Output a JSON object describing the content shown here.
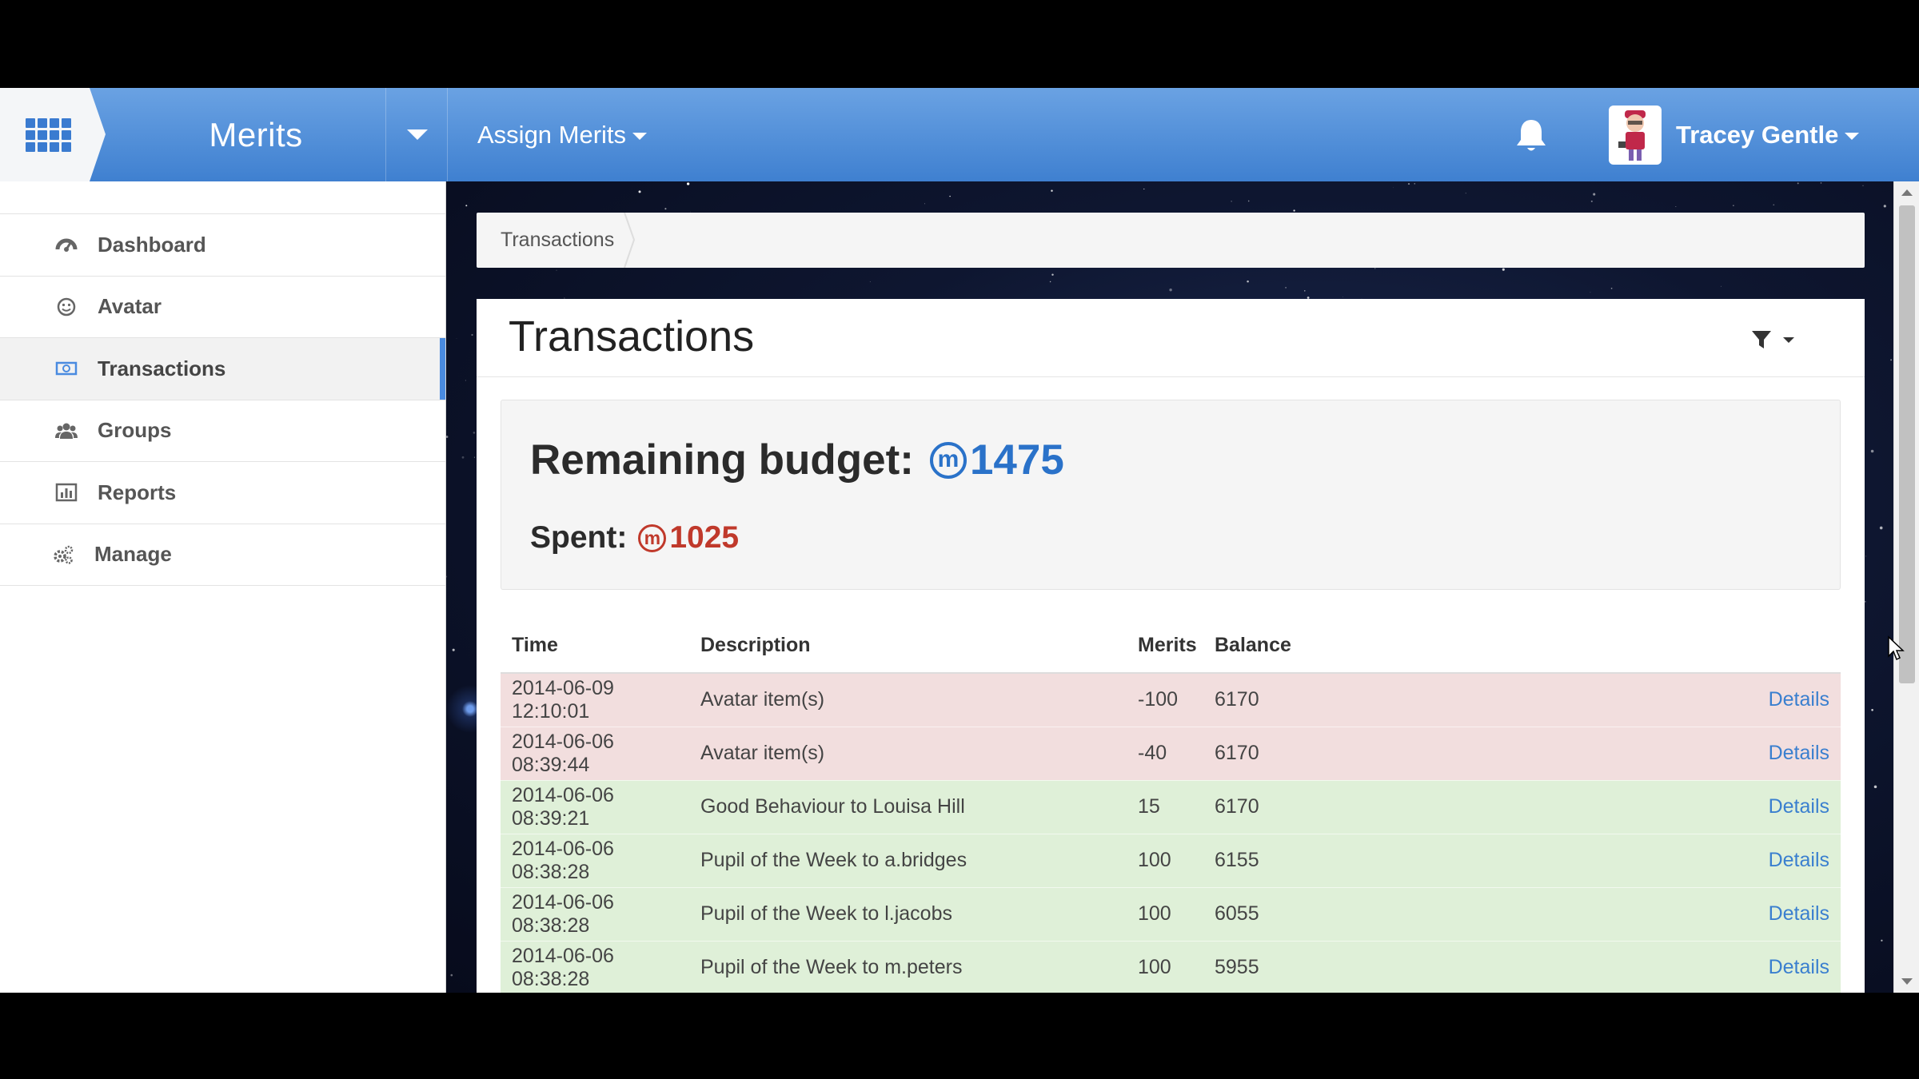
{
  "topbar": {
    "app_title": "Merits",
    "assign_menu": "Assign Merits",
    "user_name": "Tracey Gentle"
  },
  "sidebar": {
    "items": [
      {
        "label": "Dashboard",
        "icon": "dashboard-icon"
      },
      {
        "label": "Avatar",
        "icon": "smiley-icon"
      },
      {
        "label": "Transactions",
        "icon": "money-icon",
        "active": true
      },
      {
        "label": "Groups",
        "icon": "users-icon"
      },
      {
        "label": "Reports",
        "icon": "bar-chart-icon"
      },
      {
        "label": "Manage",
        "icon": "gears-icon"
      }
    ]
  },
  "breadcrumb": {
    "current": "Transactions"
  },
  "panel": {
    "title": "Transactions",
    "remaining_label": "Remaining budget:",
    "remaining_value": "1475",
    "spent_label": "Spent:",
    "spent_value": "1025",
    "merit_symbol": "m"
  },
  "table": {
    "headers": [
      "Time",
      "Description",
      "Merits",
      "Balance"
    ],
    "rows": [
      {
        "time": "2014-06-09 12:10:01",
        "description": "Avatar item(s)",
        "merits": "-100",
        "balance": "6170",
        "link": "Details"
      },
      {
        "time": "2014-06-06 08:39:44",
        "description": "Avatar item(s)",
        "merits": "-40",
        "balance": "6170",
        "link": "Details"
      },
      {
        "time": "2014-06-06 08:39:21",
        "description": "Good Behaviour to Louisa Hill",
        "merits": "15",
        "balance": "6170",
        "link": "Details"
      },
      {
        "time": "2014-06-06 08:38:28",
        "description": "Pupil of the Week to a.bridges",
        "merits": "100",
        "balance": "6155",
        "link": "Details"
      },
      {
        "time": "2014-06-06 08:38:28",
        "description": "Pupil of the Week to l.jacobs",
        "merits": "100",
        "balance": "6055",
        "link": "Details"
      },
      {
        "time": "2014-06-06 08:38:28",
        "description": "Pupil of the Week to m.peters",
        "merits": "100",
        "balance": "5955",
        "link": "Details"
      }
    ]
  },
  "colors": {
    "topbar": "#4a8ad8",
    "accent": "#2a72c9",
    "spent": "#c0392b",
    "negative_row": "#f2dede",
    "positive_row": "#dff0d8"
  }
}
